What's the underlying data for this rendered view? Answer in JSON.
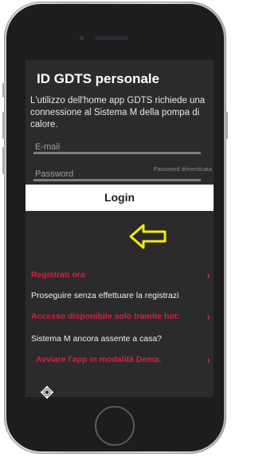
{
  "app": {
    "title": "ID GDTS personale",
    "intro": "L'utilizzo dell'home app GDTS richiede una connessione al Sistema M della pompa di calore."
  },
  "login_form": {
    "email_placeholder": "E-mail",
    "password_placeholder": "Password",
    "forgot_password_label": "Password dimenticata",
    "login_label": "Login"
  },
  "menu": [
    {
      "label": "Registrati ora",
      "style": "highlight",
      "chevron": "chevron-right-icon"
    },
    {
      "label": "Proseguire senza effettuare la registrazi",
      "style": "normal"
    },
    {
      "label": "Accesso disponibile solo tramite hot:",
      "style": "highlight",
      "chevron": "chevron-right-icon"
    },
    {
      "label": "Sistema M ancora assente a casa?",
      "style": "normal"
    },
    {
      "label": "Avviare l'app in modalità Dema.",
      "style": "highlight",
      "chevron": "chevron-right-icon"
    }
  ],
  "icons": {
    "chevron": "chevron-right-icon",
    "annotation": "yellow-left-arrow-icon",
    "brand": "brand-logo-icon"
  },
  "colors": {
    "accent": "#d8203a",
    "screen_bg": "#2b2a2c",
    "annotation_arrow": "#f5ea12"
  }
}
